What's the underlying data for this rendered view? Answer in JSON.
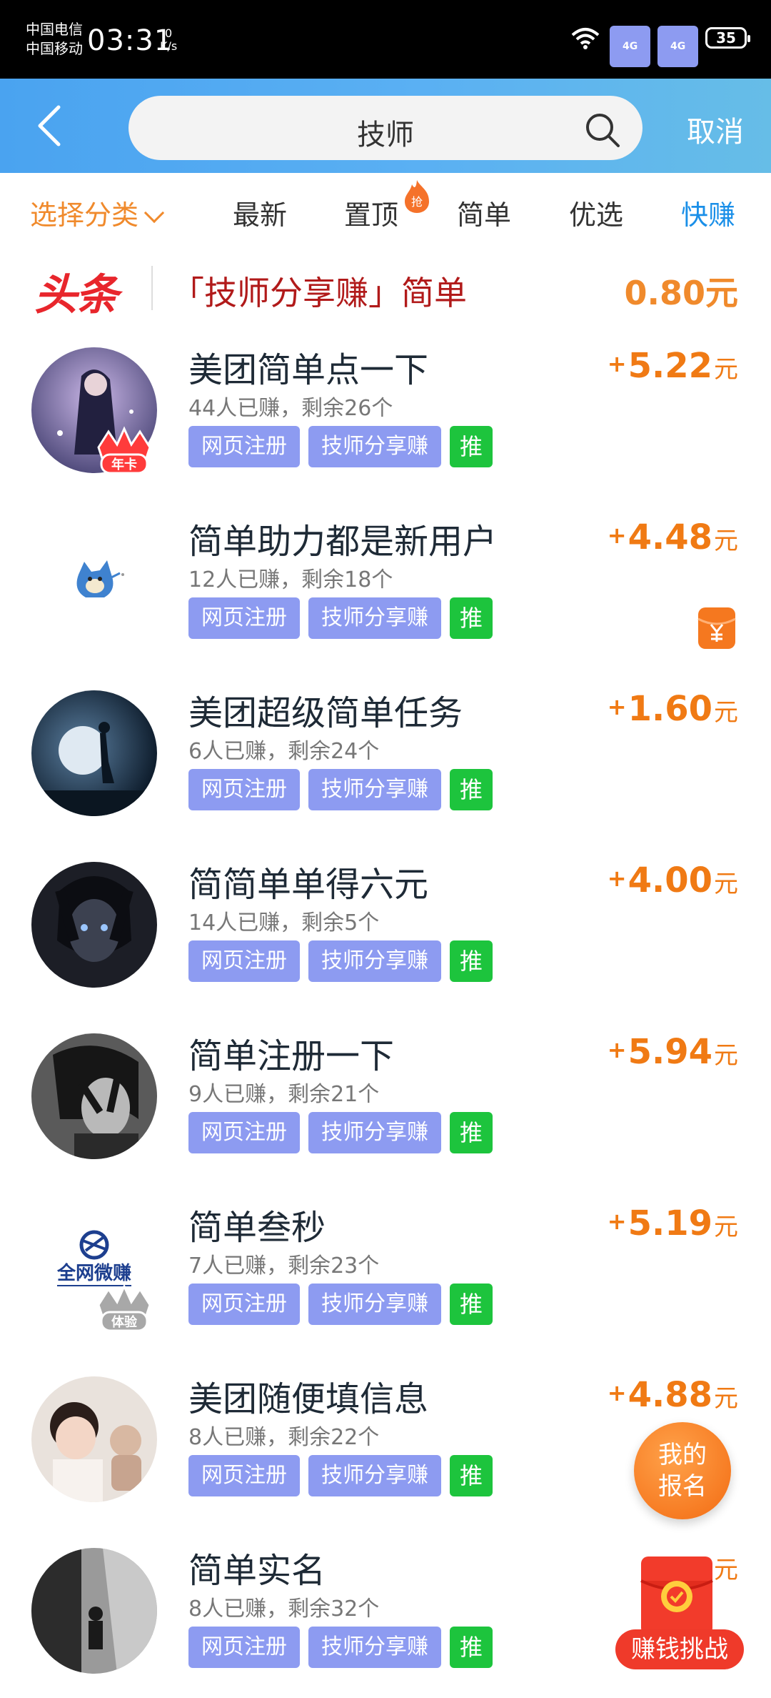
{
  "status": {
    "carrier1": "中国电信",
    "carrier2": "中国移动",
    "time": "03:31",
    "speed_value": "0",
    "speed_unit": "K/s",
    "net1": "4G",
    "net2": "4G",
    "battery": "35"
  },
  "header": {
    "search_value": "技师",
    "cancel_label": "取消"
  },
  "tabs": {
    "select_label": "选择分类",
    "items": [
      "最新",
      "置顶",
      "简单",
      "优选",
      "快赚"
    ],
    "hot_badge": "抢",
    "active_index": 4
  },
  "headline": {
    "logo": "头条",
    "title": "「技师分享赚」简单",
    "price": "0.80元"
  },
  "tag_labels": {
    "web": "网页注册",
    "share": "技师分享赚",
    "push": "推"
  },
  "reward_plus": "+",
  "reward_unit": "元",
  "tasks": [
    {
      "title": "美团简单点一下",
      "meta": "44人已赚，剩余26个",
      "reward": "5.22",
      "badge": "年卡"
    },
    {
      "title": "简单助力都是新用户",
      "meta": "12人已赚，剩余18个",
      "reward": "4.48"
    },
    {
      "title": "美团超级简单任务",
      "meta": "6人已赚，剩余24个",
      "reward": "1.60"
    },
    {
      "title": "简简单单得六元",
      "meta": "14人已赚，剩余5个",
      "reward": "4.00"
    },
    {
      "title": "简单注册一下",
      "meta": "9人已赚，剩余21个",
      "reward": "5.94"
    },
    {
      "title": "简单叁秒",
      "meta": "7人已赚，剩余23个",
      "reward": "5.19",
      "badge": "体验",
      "logo_text": "全网微赚"
    },
    {
      "title": "美团随便填信息",
      "meta": "8人已赚，剩余22个",
      "reward": "4.88"
    },
    {
      "title": "简单实名",
      "meta": "8人已赚，剩余32个",
      "reward": ""
    }
  ],
  "floating": {
    "signup_line1": "我的",
    "signup_line2": "报名",
    "challenge": "赚钱挑战"
  },
  "colors": {
    "accent_orange": "#f08a2c",
    "tab_active": "#1a8fe8",
    "tag_purple": "#8d9bf1",
    "tag_green": "#1dc43d",
    "headline_red": "#e8262c"
  }
}
